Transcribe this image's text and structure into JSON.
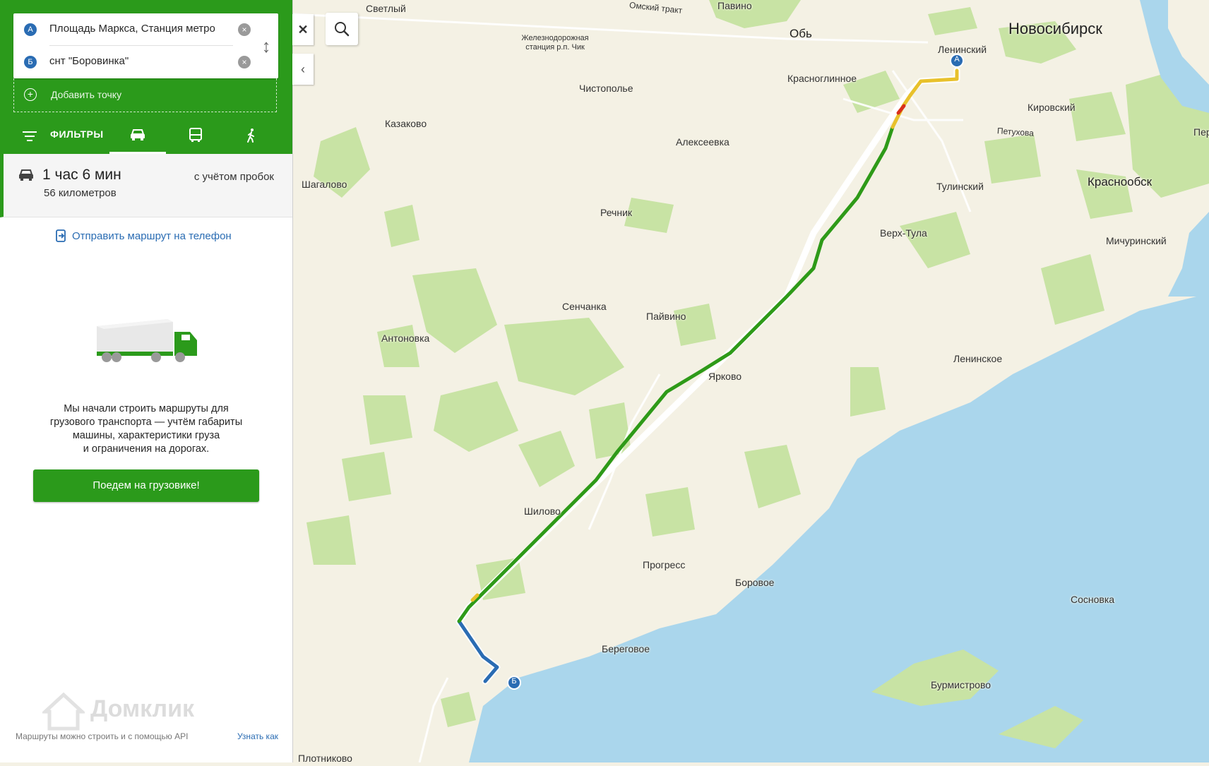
{
  "route_form": {
    "point_a": {
      "badge": "А",
      "value": "Площадь Маркса, Станция метро"
    },
    "point_b": {
      "badge": "Б",
      "value": "снт \"Боровинка\""
    },
    "add_point_label": "Добавить точку"
  },
  "tabs": {
    "filters_label": "ФИЛЬТРЫ",
    "active": "car"
  },
  "summary": {
    "duration": "1 час 6 мин",
    "distance": "56 километров",
    "traffic_note": "с учётом пробок"
  },
  "send_to_phone": "Отправить маршрут на телефон",
  "truck_promo": {
    "line1": "Мы начали строить маршруты для",
    "line2": "грузового транспорта — учтём габариты",
    "line3": "машины, характеристики груза",
    "line4": "и ограничения на дорогах.",
    "button": "Поедем на грузовике!"
  },
  "watermark": "Домклик",
  "footer": {
    "text": "Маршруты можно строить и с помощью API",
    "link": "Узнать как"
  },
  "map": {
    "labels": [
      {
        "text": "Новосибирск",
        "size": "big"
      },
      {
        "text": "Светлый",
        "size": "normal"
      },
      {
        "text": "Омский тракт",
        "size": "sm"
      },
      {
        "text": "Павино",
        "size": "normal"
      },
      {
        "text": "Обь",
        "size": "med"
      },
      {
        "text": "Железнодорожная станция р.п. Чик",
        "size": "st"
      },
      {
        "text": "Ленинский",
        "size": "normal"
      },
      {
        "text": "Красноглинное",
        "size": "normal"
      },
      {
        "text": "Чистополье",
        "size": "normal"
      },
      {
        "text": "Кировский",
        "size": "normal"
      },
      {
        "text": "Петухова",
        "size": "sm"
      },
      {
        "text": "Казаково",
        "size": "normal"
      },
      {
        "text": "Алексеевка",
        "size": "normal"
      },
      {
        "text": "Пер",
        "size": "normal"
      },
      {
        "text": "Шагалово",
        "size": "normal"
      },
      {
        "text": "Тулинский",
        "size": "normal"
      },
      {
        "text": "Краснообск",
        "size": "med"
      },
      {
        "text": "Речник",
        "size": "normal"
      },
      {
        "text": "Верх-Тула",
        "size": "normal"
      },
      {
        "text": "Мичуринский",
        "size": "normal"
      },
      {
        "text": "Сенчанка",
        "size": "normal"
      },
      {
        "text": "Пайвино",
        "size": "normal"
      },
      {
        "text": "Антоновка",
        "size": "normal"
      },
      {
        "text": "Ярково",
        "size": "normal"
      },
      {
        "text": "Ленинское",
        "size": "normal"
      },
      {
        "text": "Шилово",
        "size": "normal"
      },
      {
        "text": "Прогресс",
        "size": "normal"
      },
      {
        "text": "Боровое",
        "size": "normal"
      },
      {
        "text": "Сосновка",
        "size": "normal"
      },
      {
        "text": "Береговое",
        "size": "normal"
      },
      {
        "text": "Бурмистрово",
        "size": "normal"
      },
      {
        "text": "Плотниково",
        "size": "normal"
      }
    ],
    "marker_a": "А",
    "marker_b": "Б",
    "colors": {
      "route_green": "#2e9a18",
      "route_blue": "#2a6cb3",
      "water": "#aad6ec",
      "forest": "#c8e3a4",
      "land": "#f4f1e4",
      "brand_green": "#2b9a1b"
    }
  }
}
